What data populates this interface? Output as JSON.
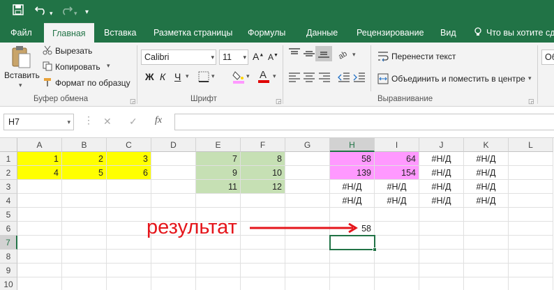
{
  "qat": {
    "save_icon": "save-icon",
    "undo_icon": "undo-icon",
    "redo_icon": "redo-icon",
    "customize_icon": "customize-icon"
  },
  "tabs": [
    "Файл",
    "Главная",
    "Вставка",
    "Разметка страницы",
    "Формулы",
    "Данные",
    "Рецензирование",
    "Вид"
  ],
  "tellme": "Что вы хотите сде",
  "ribbon": {
    "clipboard": {
      "paste": "Вставить",
      "cut": "Вырезать",
      "copy": "Копировать",
      "format_painter": "Формат по образцу",
      "label": "Буфер обмена"
    },
    "font": {
      "name": "Calibri",
      "size": "11",
      "bold": "Ж",
      "italic": "К",
      "underline": "Ч",
      "label": "Шрифт"
    },
    "alignment": {
      "wrap": "Перенести текст",
      "merge": "Объединить и поместить в центре",
      "label": "Выравнивание"
    },
    "number_format": "Об"
  },
  "formula_bar": {
    "name_box": "H7",
    "formula": "",
    "cancel": "✕",
    "enter": "✓",
    "fx": "fx"
  },
  "columns": [
    "A",
    "B",
    "C",
    "D",
    "E",
    "F",
    "G",
    "H",
    "I",
    "J",
    "K",
    "L"
  ],
  "rows": [
    "1",
    "2",
    "3",
    "4",
    "5",
    "6",
    "7",
    "8",
    "9",
    "10"
  ],
  "selected": {
    "column": "H",
    "row": "7"
  },
  "cells": {
    "A1": "1",
    "B1": "2",
    "C1": "3",
    "E1": "7",
    "F1": "8",
    "H1": "58",
    "I1": "64",
    "J1": "#Н/Д",
    "K1": "#Н/Д",
    "A2": "4",
    "B2": "5",
    "C2": "6",
    "E2": "9",
    "F2": "10",
    "H2": "139",
    "I2": "154",
    "J2": "#Н/Д",
    "K2": "#Н/Д",
    "E3": "11",
    "F3": "12",
    "H3": "#Н/Д",
    "I3": "#Н/Д",
    "J3": "#Н/Д",
    "K3": "#Н/Д",
    "H4": "#Н/Д",
    "I4": "#Н/Д",
    "J4": "#Н/Д",
    "K4": "#Н/Д",
    "H6": "58"
  },
  "annotation": {
    "text": "результат",
    "color": "#e5151b"
  },
  "colors": {
    "brand": "#217346",
    "yellow": "#ffff00",
    "green": "#c6e0b4",
    "pink": "#ff99ff"
  }
}
